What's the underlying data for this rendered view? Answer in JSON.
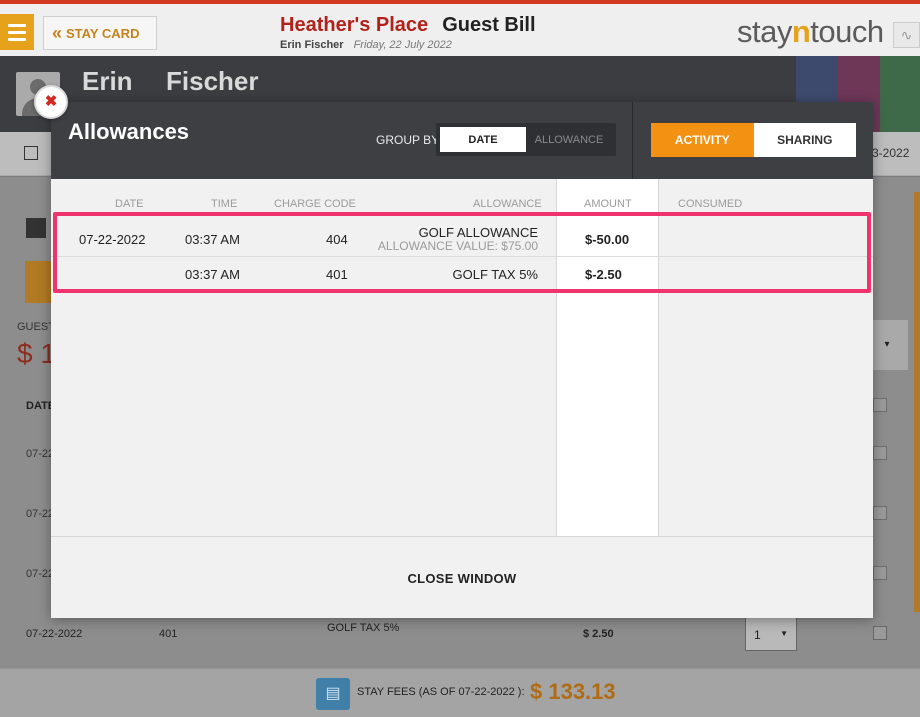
{
  "header": {
    "stay_card_label": "STAY CARD",
    "hotel_name": "Heather's Place",
    "bill_title": "Guest Bill",
    "guest_name": "Erin Fischer",
    "bill_date": "Friday, 22 July 2022",
    "brand_pre": "stay",
    "brand_mid": "n",
    "brand_post": "touch"
  },
  "guest": {
    "first_name": "Erin",
    "last_name": "Fischer"
  },
  "subbar": {
    "date_fragment": "3-2022"
  },
  "background": {
    "guest_label": "GUEST",
    "balance_fragment": "$ 1",
    "date_header": "DATE",
    "row_dates": [
      "07-22",
      "07-22",
      "07-22"
    ],
    "last_row": {
      "date": "07-22-2022",
      "code": "401",
      "description": "GOLF TAX 5%",
      "amount": "$ 2.50",
      "quantity": "1"
    },
    "stay_fees_label": "STAY FEES (AS OF  07-22-2022 ):",
    "stay_fees_amount": "$ 133.13"
  },
  "modal": {
    "title": "Allowances",
    "group_by_label": "GROUP BY",
    "group_by_options": [
      "DATE",
      "ALLOWANCE"
    ],
    "group_by_selected": "DATE",
    "view_options": [
      "ACTIVITY",
      "SHARING"
    ],
    "view_selected": "ACTIVITY",
    "columns": {
      "date": "DATE",
      "time": "TIME",
      "charge_code": "CHARGE CODE",
      "allowance": "ALLOWANCE",
      "amount": "AMOUNT",
      "consumed": "CONSUMED"
    },
    "rows": [
      {
        "date": "07-22-2022",
        "time": "03:37 AM",
        "charge_code": "404",
        "allowance": "GOLF ALLOWANCE",
        "allowance_value": "ALLOWANCE VALUE: $75.00",
        "amount": "$-50.00"
      },
      {
        "date": "",
        "time": "03:37 AM",
        "charge_code": "401",
        "allowance": "GOLF TAX 5%",
        "allowance_value": "",
        "amount": "$-2.50"
      }
    ],
    "close_label": "CLOSE WINDOW"
  },
  "colors": {
    "accent_orange": "#f29112",
    "highlight_pink": "#f0336e",
    "close_red": "#d12a20",
    "hotel_red": "#b3221a"
  }
}
